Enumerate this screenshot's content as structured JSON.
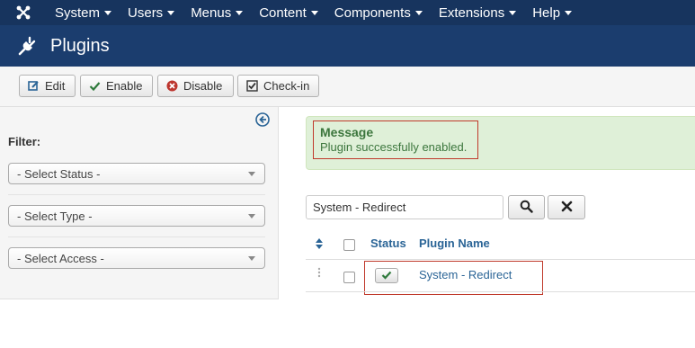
{
  "navbar": {
    "logo_icon": "joomla-logo-icon",
    "items": [
      {
        "label": "System"
      },
      {
        "label": "Users"
      },
      {
        "label": "Menus"
      },
      {
        "label": "Content"
      },
      {
        "label": "Components"
      },
      {
        "label": "Extensions"
      },
      {
        "label": "Help"
      }
    ]
  },
  "page": {
    "title": "Plugins",
    "title_icon": "plug-icon"
  },
  "toolbar": {
    "edit_label": "Edit",
    "enable_label": "Enable",
    "disable_label": "Disable",
    "checkin_label": "Check-in"
  },
  "sidebar": {
    "filter_label": "Filter:",
    "selects": [
      {
        "value": "- Select Status -"
      },
      {
        "value": "- Select Type -"
      },
      {
        "value": "- Select Access -"
      }
    ]
  },
  "message": {
    "title": "Message",
    "text": "Plugin successfully enabled."
  },
  "search": {
    "value": "System - Redirect"
  },
  "table": {
    "headers": {
      "status": "Status",
      "plugin_name": "Plugin Name"
    },
    "rows": [
      {
        "status": "enabled",
        "plugin_name": "System - Redirect"
      }
    ]
  },
  "colors": {
    "navbar": "#17345e",
    "titlebar": "#1b3d6e",
    "message_bg": "#dff0d8",
    "message_text": "#3c763d",
    "link": "#2a6496",
    "highlight": "#c0392b"
  }
}
